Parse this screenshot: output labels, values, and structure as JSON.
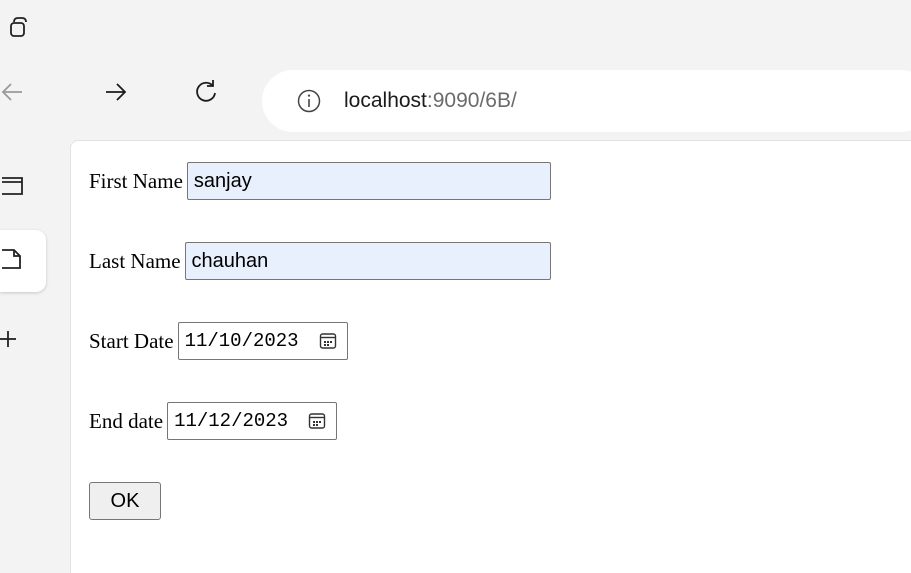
{
  "browser": {
    "url_host": "localhost",
    "url_path": ":9090/6B/",
    "icons": {
      "workspace": "workspace-icon",
      "back": "back-arrow-icon",
      "forward": "forward-arrow-icon",
      "refresh": "refresh-icon",
      "info": "info-icon",
      "tab_actions": "tab-actions-icon",
      "page_tab": "page-icon",
      "new_tab": "plus-icon"
    }
  },
  "form": {
    "first_name_label": "First Name",
    "first_name_value": "sanjay",
    "last_name_label": "Last Name",
    "last_name_value": "chauhan",
    "start_date_label": "Start Date",
    "start_date_value": "11/10/2023",
    "end_date_label": "End date",
    "end_date_value": "11/12/2023",
    "ok_label": "OK"
  },
  "colors": {
    "autofill_bg": "#e8f0fe",
    "chrome_bg": "#f3f3f3",
    "input_border": "#767676"
  }
}
